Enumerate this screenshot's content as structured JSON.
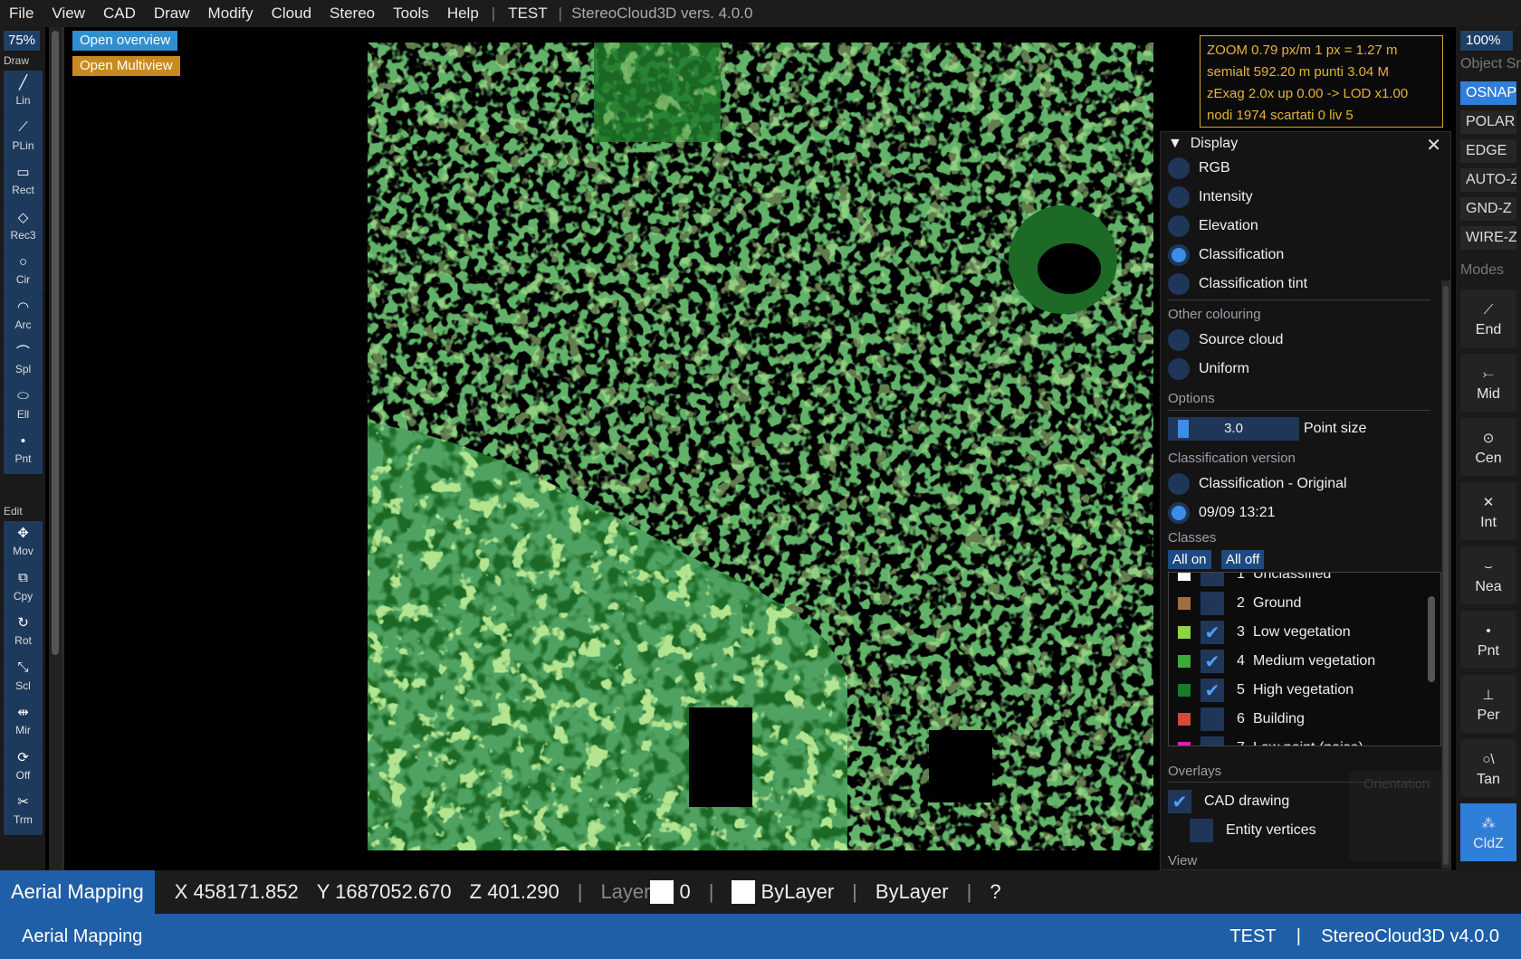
{
  "menu": {
    "items": [
      "File",
      "View",
      "CAD",
      "Draw",
      "Modify",
      "Cloud",
      "Stereo",
      "Tools",
      "Help"
    ],
    "project": "TEST",
    "separator": "|",
    "version": "StereoCloud3D vers. 4.0.0"
  },
  "left_toolbar": {
    "zoom": "75%",
    "draw_label": "Draw",
    "edit_label": "Edit",
    "draw_tools": [
      {
        "label": "Lin",
        "icon": "line-icon"
      },
      {
        "label": "PLin",
        "icon": "polyline-icon"
      },
      {
        "label": "Rect",
        "icon": "rectangle-icon"
      },
      {
        "label": "Rec3",
        "icon": "rect3-icon"
      },
      {
        "label": "Cir",
        "icon": "circle-icon"
      },
      {
        "label": "Arc",
        "icon": "arc-icon"
      },
      {
        "label": "Spl",
        "icon": "spline-icon"
      },
      {
        "label": "Ell",
        "icon": "ellipse-icon"
      },
      {
        "label": "Pnt",
        "icon": "point-icon"
      }
    ],
    "edit_tools": [
      {
        "label": "Mov",
        "icon": "move-icon"
      },
      {
        "label": "Cpy",
        "icon": "copy-icon"
      },
      {
        "label": "Rot",
        "icon": "rotate-icon"
      },
      {
        "label": "Scl",
        "icon": "scale-icon"
      },
      {
        "label": "Mir",
        "icon": "mirror-icon"
      },
      {
        "label": "Off",
        "icon": "offset-icon"
      },
      {
        "label": "Trm",
        "icon": "trim-icon"
      }
    ]
  },
  "overview": {
    "open_overview": "Open overview",
    "open_multiview": "Open Multiview",
    "overview_color": "#2f8fd0",
    "multiview_color": "#c8891e"
  },
  "info": {
    "line1": "ZOOM  0.79 px/m    1 px = 1.27 m",
    "line2": "semialt 592.20 m       punti 3.04 M",
    "line3": "zExag 2.0x  up 0.00  ->  LOD x1.00",
    "line4": "nodi 1974  scartati 0  liv 5"
  },
  "display_panel": {
    "title": "Display",
    "modes": [
      {
        "label": "RGB",
        "selected": false
      },
      {
        "label": "Intensity",
        "selected": false
      },
      {
        "label": "Elevation",
        "selected": false
      },
      {
        "label": "Classification",
        "selected": true
      },
      {
        "label": "Classification tint",
        "selected": false
      }
    ],
    "other_colouring_label": "Other colouring",
    "other_colouring": [
      {
        "label": "Source cloud",
        "selected": false
      },
      {
        "label": "Uniform",
        "selected": false
      }
    ],
    "options_label": "Options",
    "point_size_value": "3.0",
    "point_size_label": "Point size",
    "classification_version_label": "Classification version",
    "versions": [
      {
        "label": "Classification - Original",
        "selected": false
      },
      {
        "label": "09/09 13:21",
        "selected": true
      }
    ],
    "classes_label": "Classes",
    "all_on": "All on",
    "all_off": "All off",
    "classes": [
      {
        "num": "1",
        "name": "Unclassified",
        "color": "#ffffff",
        "checked": false
      },
      {
        "num": "2",
        "name": "Ground",
        "color": "#a0703f",
        "checked": false
      },
      {
        "num": "3",
        "name": "Low vegetation",
        "color": "#8fd34a",
        "checked": true
      },
      {
        "num": "4",
        "name": "Medium vegetation",
        "color": "#3fa83a",
        "checked": true
      },
      {
        "num": "5",
        "name": "High vegetation",
        "color": "#1a7a2a",
        "checked": true
      },
      {
        "num": "6",
        "name": "Building",
        "color": "#d24a3a",
        "checked": false
      },
      {
        "num": "7",
        "name": "Low point (noise)",
        "color": "#e020b0",
        "checked": false
      }
    ],
    "overlays_label": "Overlays",
    "cad_drawing": "CAD drawing",
    "entity_vertices": "Entity vertices",
    "view_label": "View",
    "orientation_label": "Orientation"
  },
  "right_toolbar": {
    "zoom": "100%",
    "object_label": "Object Sna",
    "modes_label": "Modes",
    "mode_buttons": [
      {
        "label": "OSNAP",
        "on": true
      },
      {
        "label": "POLAR",
        "on": false
      },
      {
        "label": "EDGE",
        "on": false
      },
      {
        "label": "AUTO-Z",
        "on": false
      },
      {
        "label": "GND-Z",
        "on": false
      },
      {
        "label": "WIRE-Z",
        "on": false
      }
    ],
    "snaps": [
      {
        "label": "End",
        "icon": "endpoint-icon",
        "on": false
      },
      {
        "label": "Mid",
        "icon": "midpoint-icon",
        "on": false
      },
      {
        "label": "Cen",
        "icon": "center-icon",
        "on": false
      },
      {
        "label": "Int",
        "icon": "intersection-icon",
        "on": false
      },
      {
        "label": "Nea",
        "icon": "nearest-icon",
        "on": false
      },
      {
        "label": "Pnt",
        "icon": "point-snap-icon",
        "on": false
      },
      {
        "label": "Per",
        "icon": "perpendicular-icon",
        "on": false
      },
      {
        "label": "Tan",
        "icon": "tangent-icon",
        "on": false
      },
      {
        "label": "CldZ",
        "icon": "cloud-z-icon",
        "on": true
      }
    ]
  },
  "status": {
    "app": "Aerial Mapping",
    "x": "X 458171.852",
    "y": "Y 1687052.670",
    "z": "Z 401.290",
    "sep": "|",
    "layer_label": "Layer",
    "layer_value": "0",
    "color_value": "ByLayer",
    "linetype_value": "ByLayer",
    "help": "?"
  },
  "bottom": {
    "left": "Aerial Mapping",
    "project": "TEST",
    "sep": "|",
    "product": "StereoCloud3D v4.0.0"
  }
}
